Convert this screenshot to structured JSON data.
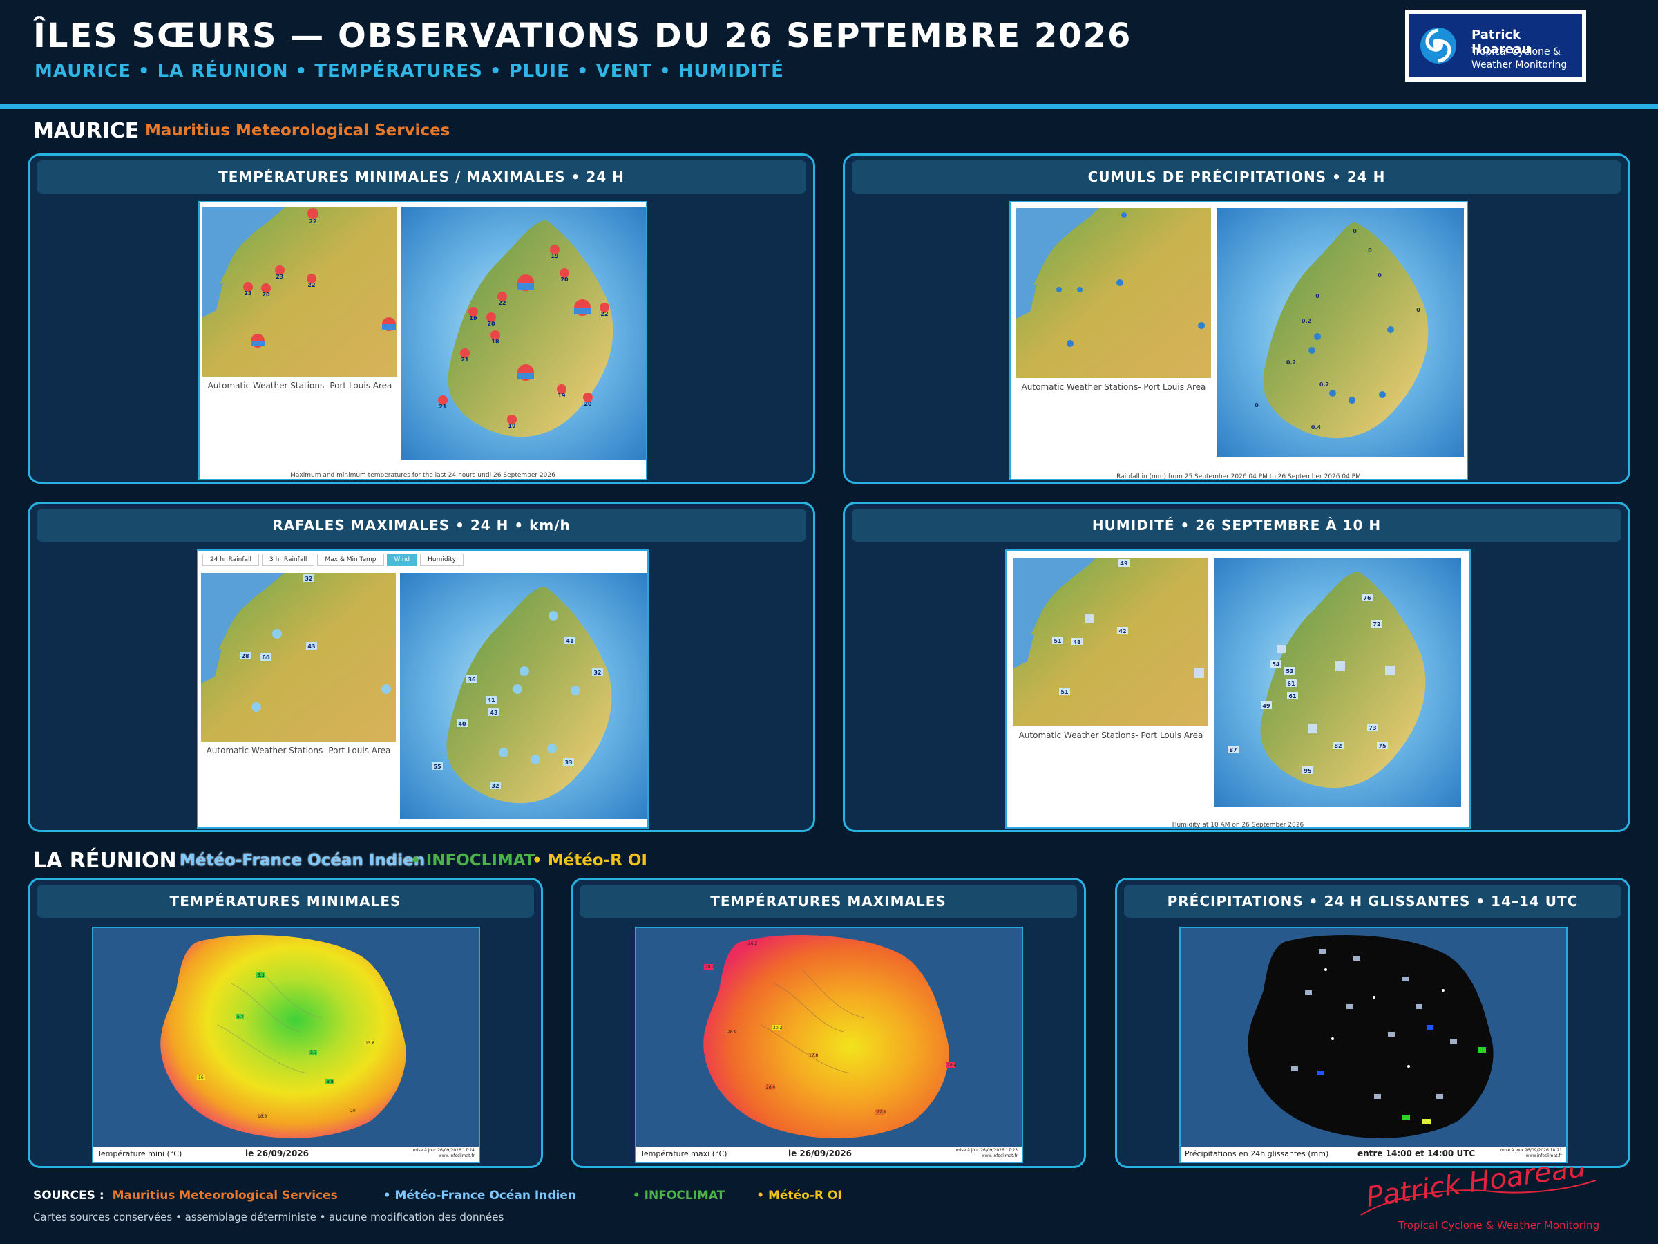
{
  "header": {
    "title": "ÎLES SŒURS — OBSERVATIONS DU 26 SEPTEMBRE 2026",
    "subtitle": "MAURICE • LA RÉUNION • TEMPÉRATURES • PLUIE • VENT • HUMIDITÉ",
    "logo_name": "Patrick Hoareau",
    "logo_sub1": "Tropical Cyclone &",
    "logo_sub2": "Weather Monitoring"
  },
  "maurice": {
    "title": "MAURICE",
    "source": "Mauritius Meteorological Services",
    "panels": {
      "temps": {
        "title": "TEMPÉRATURES MINIMALES / MAXIMALES • 24 H",
        "caption": "Automatic Weather Stations- Port Louis Area",
        "footnote": "Maximum and minimum temperatures for the last 24 hours until 26 September 2026",
        "markers": [
          "26/22",
          "28/23",
          "26/22",
          "24/23",
          "26/20",
          "27/19",
          "24/20",
          "28/22",
          "29/19",
          "28/20",
          "27/19",
          "26/18",
          "29/21",
          "25/19",
          "26/20",
          "26/21",
          "27/19",
          "26/22"
        ]
      },
      "rain": {
        "title": "CUMULS DE PRÉCIPITATIONS • 24 H",
        "caption": "Automatic Weather Stations- Port Louis Area",
        "footnote": "Rainfall in (mm) from 25 September 2026 04 PM to 26 September 2026 04 PM",
        "markers": [
          "0",
          "0",
          "0",
          "0",
          "0",
          "0",
          "0",
          "0.2",
          "0",
          "0.2",
          "0.2",
          "0",
          "0",
          "0",
          "0.4"
        ]
      },
      "wind": {
        "title": "RAFALES MAXIMALES • 24 H • km/h",
        "caption": "Automatic Weather Stations- Port Louis Area",
        "tabs": [
          "24 hr Rainfall",
          "3 hr Rainfall",
          "Max & Min Temp",
          "Wind",
          "Humidity"
        ],
        "markers": [
          "32",
          "28",
          "60",
          "43",
          "41",
          "36",
          "32",
          "41",
          "43",
          "40",
          "55",
          "33",
          "32"
        ]
      },
      "humidity": {
        "title": "HUMIDITÉ • 26 SEPTEMBRE À 10 H",
        "caption": "Automatic Weather Stations- Port Louis Area",
        "footnote": "Humidity at 10 AM on 26 September 2026",
        "markers": [
          "49",
          "51",
          "48",
          "42",
          "51",
          "76",
          "72",
          "54",
          "53",
          "61",
          "61",
          "49",
          "73",
          "82",
          "75",
          "87",
          "95"
        ]
      }
    }
  },
  "reunion": {
    "title": "LA RÉUNION",
    "sources": [
      "Météo-France Océan Indien",
      "• INFOCLIMAT",
      "• Météo-R OI"
    ],
    "panels": {
      "tmin": {
        "title": "TEMPÉRATURES MINIMALES",
        "legend": "Température mini (°C)",
        "date": "le 26/09/2026",
        "update": "mise à jour 26/09/2026 17:24",
        "site": "www.infoclimat.fr"
      },
      "tmax": {
        "title": "TEMPÉRATURES MAXIMALES",
        "legend": "Température maxi (°C)",
        "date": "le 26/09/2026",
        "update": "mise à jour 26/09/2026 17:23",
        "site": "www.infoclimat.fr"
      },
      "rain": {
        "title": "PRÉCIPITATIONS • 24 H GLISSANTES • 14–14 UTC",
        "legend": "Précipitations en 24h glissantes (mm)",
        "date": "entre 14:00 et 14:00 UTC",
        "update": "mise à jour 26/09/2026 18:21",
        "site": "www.infoclimat.fr"
      }
    }
  },
  "footer": {
    "label": "SOURCES :",
    "sources": [
      "Mauritius Meteorological Services",
      "• Météo-France Océan Indien",
      "• INFOCLIMAT",
      "• Météo-R OI"
    ],
    "note": "Cartes sources conservées • assemblage déterministe • aucune modification des données",
    "signature": "Patrick Hoareau",
    "signature_sub": "Tropical Cyclone & Weather Monitoring"
  },
  "colors": {
    "background": "#071a2d",
    "accent": "#27b2e2",
    "orange": "#e8782a",
    "green": "#4cb34a",
    "yellow": "#f2c21b",
    "light_blue": "#7cc8ff",
    "red": "#e2233b"
  }
}
